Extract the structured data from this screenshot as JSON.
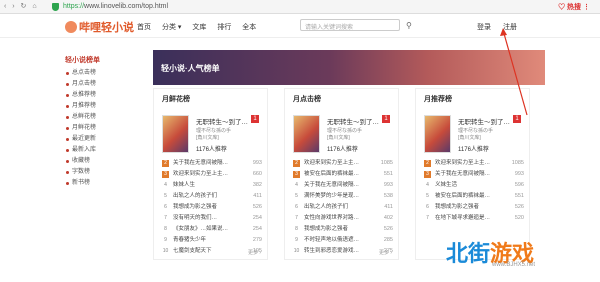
{
  "browser": {
    "nav": "‹ › ↻ ⌂",
    "url_https": "https://",
    "url_rest": "www.linovelib.com/top.html",
    "right": "♡ 热搜 ⋮",
    "hot": "热搜"
  },
  "header": {
    "logo": "哔哩轻小说",
    "nav": [
      "首页",
      "分类 ▾",
      "文库",
      "排行",
      "全本"
    ],
    "search_placeholder": "请输入关键词搜索",
    "search_icon": "search-icon",
    "login": "登录",
    "register": "注册"
  },
  "sidebar": {
    "title": "轻小说榜单",
    "items": [
      "总点击榜",
      "月点击榜",
      "总推荐榜",
      "月推荐榜",
      "总鲜花榜",
      "月鲜花榜",
      "最近更新",
      "最新入库",
      "收藏榜",
      "字数榜",
      "新书榜"
    ]
  },
  "banner": {
    "title": "轻小说·人气榜单"
  },
  "panels": [
    {
      "title": "月鲜花榜",
      "top": {
        "title": "无职转生～到了…",
        "rank": "1",
        "author": "理不尽な孫の手",
        "publisher": "[角川文库]",
        "rec": "1176人推荐"
      },
      "rows": [
        {
          "n": "2",
          "t": "关于我在无意间被隔…",
          "c": "993"
        },
        {
          "n": "3",
          "t": "欢迎来到实力至上主…",
          "c": "660"
        },
        {
          "n": "4",
          "t": "妹妹人生",
          "c": "382"
        },
        {
          "n": "5",
          "t": "出轨之人的孩子们",
          "c": "411"
        },
        {
          "n": "6",
          "t": "我想成为影之强者",
          "c": "526"
        },
        {
          "n": "7",
          "t": "没有明天的我们…",
          "c": "254"
        },
        {
          "n": "8",
          "t": "《女朋友》…如果说…",
          "c": "254"
        },
        {
          "n": "9",
          "t": "青春猪头少年",
          "c": "279"
        },
        {
          "n": "10",
          "t": "七魔剑支配天下",
          "c": "195"
        }
      ],
      "more": "更多 ›"
    },
    {
      "title": "月点击榜",
      "top": {
        "title": "无职转生～到了…",
        "rank": "1",
        "author": "理不尽な孫の手",
        "publisher": "[角川文库]",
        "rec": "1176人推荐"
      },
      "rows": [
        {
          "n": "2",
          "t": "欢迎来到实力至上主…",
          "c": "1085"
        },
        {
          "n": "3",
          "t": "被安在后面的裤袜最…",
          "c": "551"
        },
        {
          "n": "4",
          "t": "关于我在无意间被隔…",
          "c": "993"
        },
        {
          "n": "5",
          "t": "满怀美梦的少年是现…",
          "c": "538"
        },
        {
          "n": "6",
          "t": "出轨之人的孩子们",
          "c": "411"
        },
        {
          "n": "7",
          "t": "女性向游戏世界对路…",
          "c": "402"
        },
        {
          "n": "8",
          "t": "我想成为影之强者",
          "c": "526"
        },
        {
          "n": "9",
          "t": "不时轻声地以俄语遮…",
          "c": "285"
        },
        {
          "n": "10",
          "t": "转生到邪恶恋爱游戏…",
          "c": "275"
        }
      ],
      "more": "更多 ›"
    },
    {
      "title": "月推荐榜",
      "top": {
        "title": "无职转生～到了…",
        "rank": "1",
        "author": "理不尽な孫の手",
        "publisher": "[角川文库]",
        "rec": "1176人推荐"
      },
      "rows": [
        {
          "n": "2",
          "t": "欢迎来到实力至上主…",
          "c": "1085"
        },
        {
          "n": "3",
          "t": "关于我在无意间被隔…",
          "c": "993"
        },
        {
          "n": "4",
          "t": "义妹生活",
          "c": "596"
        },
        {
          "n": "5",
          "t": "被安在后面的裤袜最…",
          "c": "551"
        },
        {
          "n": "6",
          "t": "我想成为影之强者",
          "c": "526"
        },
        {
          "n": "7",
          "t": "在地下城寻求邂逅是…",
          "c": "520"
        }
      ],
      "more": ""
    }
  ],
  "watermark": {
    "a": "北街",
    "b": "游戏",
    "url": "www.BJHX5.net"
  }
}
